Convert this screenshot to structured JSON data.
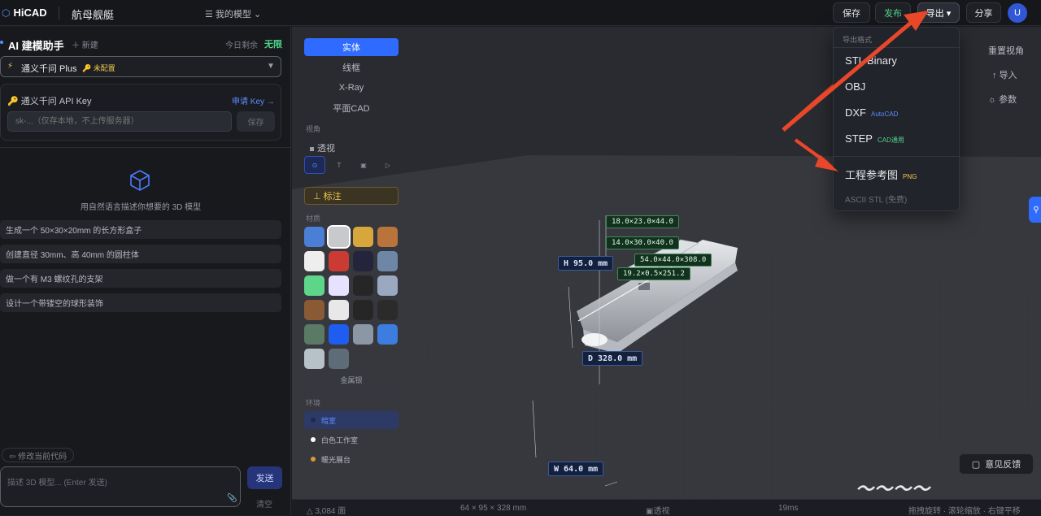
{
  "topbar": {
    "logo": "HiCAD",
    "logo_icon": "hexagon-icon",
    "project_title": "航母舰艇",
    "my_models": "☰  我的模型  ⌄",
    "save": "保存",
    "publish": "发布",
    "export": "导出 ▾",
    "share": "分享",
    "avatar": "U"
  },
  "left": {
    "ai_title": "AI 建模助手",
    "new": "＋ 新建",
    "quota_label": "今日剩余",
    "quota_value": "无限",
    "model_icon": "⚡",
    "model_name": "通义千问 Plus",
    "model_badge": "🔑 未配置",
    "model_caret": "▼",
    "api_key_label": "🔑 通义千问 API Key",
    "apply_key": "申请 Key →",
    "api_placeholder": "sk-...（仅存本地，不上传服务器）",
    "api_save": "保存",
    "hint": "用自然语言描述你想要的 3D 模型",
    "suggestions": [
      "生成一个 50×30×20mm 的长方形盒子",
      "创建直径 30mm、高 40mm 的圆柱体",
      "做一个有 M3 螺纹孔的支架",
      "设计一个带镂空的球形装饰"
    ],
    "modify_code": "⇦ 修改当前代码",
    "prompt_placeholder": "描述 3D 模型... (Enter 发送)",
    "send": "发送",
    "clear": "清空"
  },
  "tools": {
    "view_modes": [
      "实体",
      "线框",
      "X-Ray",
      "平面CAD"
    ],
    "view_label": "视角",
    "perspective": "透视",
    "view_buttons": [
      "⊙",
      "T",
      "▣",
      "▷"
    ],
    "annotate": "⊥ 标注",
    "material_label": "材质",
    "material_name": "金属银",
    "swatch_colors": [
      "#4b7fd6",
      "#c8c9cc",
      "#d8a73c",
      "#b8743a",
      "#eeeeee",
      "#cc3b33",
      "#24243d",
      "#6f87a6",
      "#5ed68a",
      "#e6e2ff",
      "#262626",
      "#9aa8c0",
      "#8a5a34",
      "#e8e8e8",
      "#262626",
      "#2b2b2b",
      "#5a7a66",
      "#1f5cf0",
      "#8c97a6",
      "#3d7de0",
      "#b7c1c8",
      "#5e6c78"
    ],
    "env_label": "环境",
    "envs": [
      {
        "name": "暗室",
        "dot": "#1e2a55"
      },
      {
        "name": "白色工作室",
        "dot": "#ffffff"
      },
      {
        "name": "暖光展台",
        "dot": "#d89a3a"
      }
    ]
  },
  "viewport": {
    "reset_view": "重置视角",
    "import": "↑ 导入",
    "params": "☼ 参数",
    "dims": {
      "h": "H 95.0 mm",
      "d": "D 328.0 mm",
      "w": "W 64.0 mm",
      "g1": "18.0×23.0×44.0",
      "g2": "14.0×30.0×40.0",
      "g3": "54.0×44.0×308.0",
      "g4": "19.2×0.5×251.2"
    },
    "feedback": "意见反馈"
  },
  "status": {
    "faces": "△ 3,084 面",
    "size": "64 × 95 × 328 mm",
    "projection": "▣透视",
    "time": "19ms",
    "help": "拖拽旋转 · 滚轮缩放 · 右键平移"
  },
  "export_menu": {
    "title": "导出格式",
    "stl": "STL Binary",
    "obj": "OBJ",
    "dxf": "DXF",
    "dxf_tag": "AutoCAD",
    "step": "STEP",
    "step_tag": "CAD通用",
    "drawing": "工程参考图",
    "drawing_tag": "PNG",
    "ascii": "ASCII STL (免费)"
  },
  "colors": {
    "accent": "#2f6bff",
    "arrow": "#e8472a",
    "green": "#4fd38a"
  }
}
